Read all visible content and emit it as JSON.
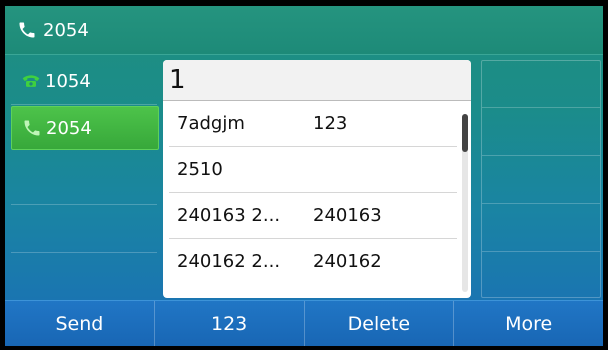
{
  "title": {
    "number": "2054"
  },
  "lines": [
    {
      "label": "1054",
      "icon": "phone-handset-icon",
      "active": false
    },
    {
      "label": "2054",
      "icon": "phone-icon",
      "active": true
    }
  ],
  "search": {
    "query": "1"
  },
  "results": [
    {
      "name": "7adgjm",
      "number": "123"
    },
    {
      "name": "2510",
      "number": ""
    },
    {
      "name": "240163 2...",
      "number": "240163"
    },
    {
      "name": "240162 2...",
      "number": "240162"
    }
  ],
  "softkeys": [
    "Send",
    "123",
    "Delete",
    "More"
  ],
  "colors": {
    "active_line": "#3fb03f",
    "softkey_bar": "#1a6db8"
  }
}
